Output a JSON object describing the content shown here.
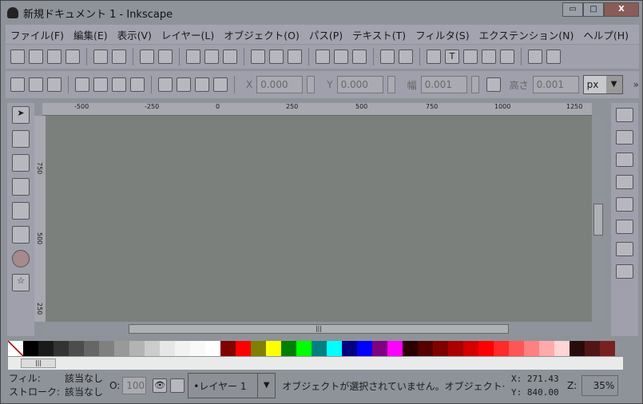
{
  "window": {
    "title": "新規ドキュメント 1 - Inkscape",
    "minimize": "▭",
    "maximize": "□",
    "close": "X"
  },
  "menu": [
    "ファイル(F)",
    "編集(E)",
    "表示(V)",
    "レイヤー(L)",
    "オブジェクト(O)",
    "パス(P)",
    "テキスト(T)",
    "フィルタ(S)",
    "エクステンション(N)",
    "ヘルプ(H)"
  ],
  "toolbar2": {
    "x_label": "X",
    "x_value": "0.000",
    "y_label": "Y",
    "y_value": "0.000",
    "w_label": "幅",
    "w_value": "0.001",
    "h_label": "高さ",
    "h_value": "0.001",
    "unit": "px",
    "more": "»"
  },
  "ruler_h": [
    "-500",
    "-250",
    "0",
    "250",
    "500",
    "750",
    "1000",
    "1250"
  ],
  "ruler_v": [
    "750",
    "500",
    "250"
  ],
  "palette": [
    "#000000",
    "#1a1a1a",
    "#333333",
    "#4d4d4d",
    "#666666",
    "#808080",
    "#999999",
    "#b3b3b3",
    "#cccccc",
    "#e6e6e6",
    "#f2f2f2",
    "#f9f9f9",
    "#ffffff",
    "#800000",
    "#ff0000",
    "#808000",
    "#ffff00",
    "#008000",
    "#00ff00",
    "#008080",
    "#00ffff",
    "#000080",
    "#0000ff",
    "#800080",
    "#ff00ff",
    "#2b0000",
    "#550000",
    "#800000",
    "#aa0000",
    "#d40000",
    "#ff0000",
    "#ff2a2a",
    "#ff5555",
    "#ff8080",
    "#ffaaaa",
    "#ffd5d5",
    "#280b0b",
    "#501616",
    "#782121"
  ],
  "status": {
    "fill_label": "フィル:",
    "fill_value": "該当なし",
    "stroke_label": "ストローク:",
    "stroke_value": "該当なし",
    "opacity_label": "O:",
    "opacity_value": "100",
    "layer": "•レイヤー 1",
    "message": "オブジェクトが選択されていません。オブジェクト·",
    "x_label": "X:",
    "x_value": "271.43",
    "y_label": "Y:",
    "y_value": "840.00",
    "zoom_label": "Z:",
    "zoom_value": "35%"
  }
}
